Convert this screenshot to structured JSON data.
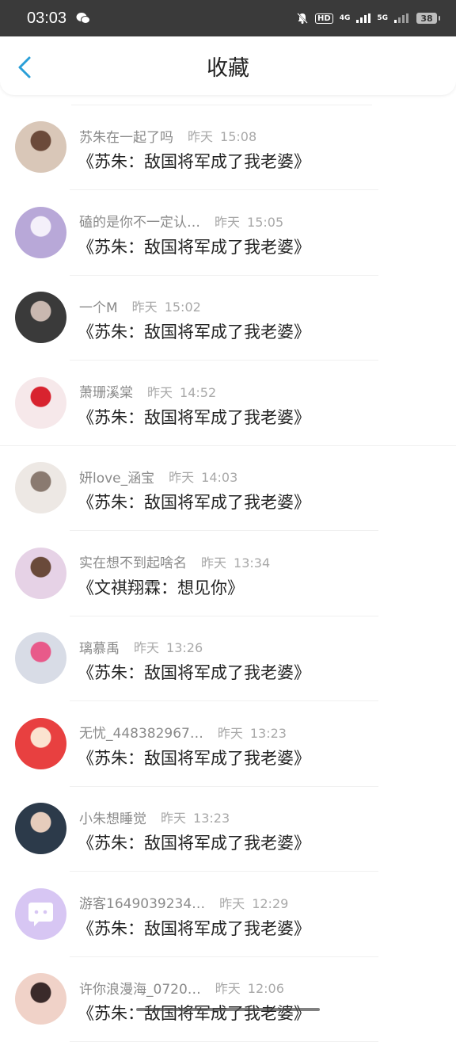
{
  "status_bar": {
    "time": "03:03",
    "hd_label": "HD",
    "net1": "4G",
    "net2": "5G",
    "battery": "38"
  },
  "header": {
    "title": "收藏"
  },
  "items": [
    {
      "username": "苏朱在一起了吗",
      "date": "昨天",
      "time": "15:08",
      "title": "《苏朱：敌国将军成了我老婆》",
      "avatar_color": "#d9c7b8",
      "avatar_accent": "#6b4a3a"
    },
    {
      "username": "磕的是你不一定认…",
      "date": "昨天",
      "time": "15:05",
      "title": "《苏朱：敌国将军成了我老婆》",
      "avatar_color": "#b8a8d8",
      "avatar_accent": "#f4f0fa"
    },
    {
      "username": "一个M",
      "date": "昨天",
      "time": "15:02",
      "title": "《苏朱：敌国将军成了我老婆》",
      "avatar_color": "#3a3a3a",
      "avatar_accent": "#c9b8b0"
    },
    {
      "username": "萧珊溪棠",
      "date": "昨天",
      "time": "14:52",
      "title": "《苏朱：敌国将军成了我老婆》",
      "avatar_color": "#f6e8ea",
      "avatar_accent": "#d8232f"
    },
    {
      "username": "妍love_涵宝",
      "date": "昨天",
      "time": "14:03",
      "title": "《苏朱：敌国将军成了我老婆》",
      "avatar_color": "#ede8e4",
      "avatar_accent": "#8a7a70"
    },
    {
      "username": "实在想不到起啥名",
      "date": "昨天",
      "time": "13:34",
      "title": "《文祺翔霖：想见你》",
      "avatar_color": "#e6d2e6",
      "avatar_accent": "#6a4a3a"
    },
    {
      "username": "璃慕禹",
      "date": "昨天",
      "time": "13:26",
      "title": "《苏朱：敌国将军成了我老婆》",
      "avatar_color": "#d8dce6",
      "avatar_accent": "#e85a8a"
    },
    {
      "username": "无忧_448382967…",
      "date": "昨天",
      "time": "13:23",
      "title": "《苏朱：敌国将军成了我老婆》",
      "avatar_color": "#e84040",
      "avatar_accent": "#fbe3d0"
    },
    {
      "username": "小朱想睡觉",
      "date": "昨天",
      "time": "13:23",
      "title": "《苏朱：敌国将军成了我老婆》",
      "avatar_color": "#2c3a4a",
      "avatar_accent": "#e6ccbc"
    },
    {
      "username": "游客1649039234…",
      "date": "昨天",
      "time": "12:29",
      "title": "《苏朱：敌国将军成了我老婆》",
      "avatar_color": "#d7c6f3",
      "avatar_accent": "#ffffff"
    },
    {
      "username": "许你浪漫海_0720…",
      "date": "昨天",
      "time": "12:06",
      "title": "《苏朱：敌国将军成了我老婆》",
      "avatar_color": "#f0d2c8",
      "avatar_accent": "#3a2a2a"
    }
  ]
}
